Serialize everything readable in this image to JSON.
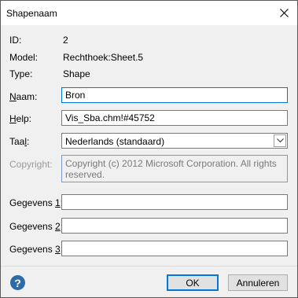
{
  "window": {
    "title": "Shapenaam"
  },
  "info": {
    "id_label": "ID:",
    "id_value": "2",
    "model_label": "Model:",
    "model_value": "Rechthoek:Sheet.5",
    "type_label": "Type:",
    "type_value": "Shape"
  },
  "fields": {
    "name": {
      "label_accel": "N",
      "label_rest": "aam:",
      "value": "Bron"
    },
    "help": {
      "label_accel": "H",
      "label_rest": "elp:",
      "value": "Vis_Sba.chm!#45752"
    },
    "language": {
      "label_pre": "Taa",
      "label_accel": "l",
      "label_post": ":",
      "value": "Nederlands (standaard)"
    },
    "copyright": {
      "label": "Copyright:",
      "value": "Copyright (c) 2012 Microsoft Corporation.  All rights reserved."
    },
    "data1": {
      "label_pre": "Gegevens ",
      "label_accel": "1",
      "label_post": ":",
      "value": ""
    },
    "data2": {
      "label_pre": "Gegevens ",
      "label_accel": "2",
      "label_post": ":",
      "value": ""
    },
    "data3": {
      "label_pre": "Gegevens ",
      "label_accel": "3",
      "label_post": ":",
      "value": ""
    }
  },
  "buttons": {
    "help_glyph": "?",
    "ok": "OK",
    "cancel": "Annuleren"
  },
  "colors": {
    "accent": "#0078d7",
    "help_icon": "#2d6aa8",
    "disabled_text": "#9a9a9a"
  },
  "icons": {
    "close": "close-icon",
    "dropdown": "chevron-down-icon",
    "help": "help-icon"
  }
}
